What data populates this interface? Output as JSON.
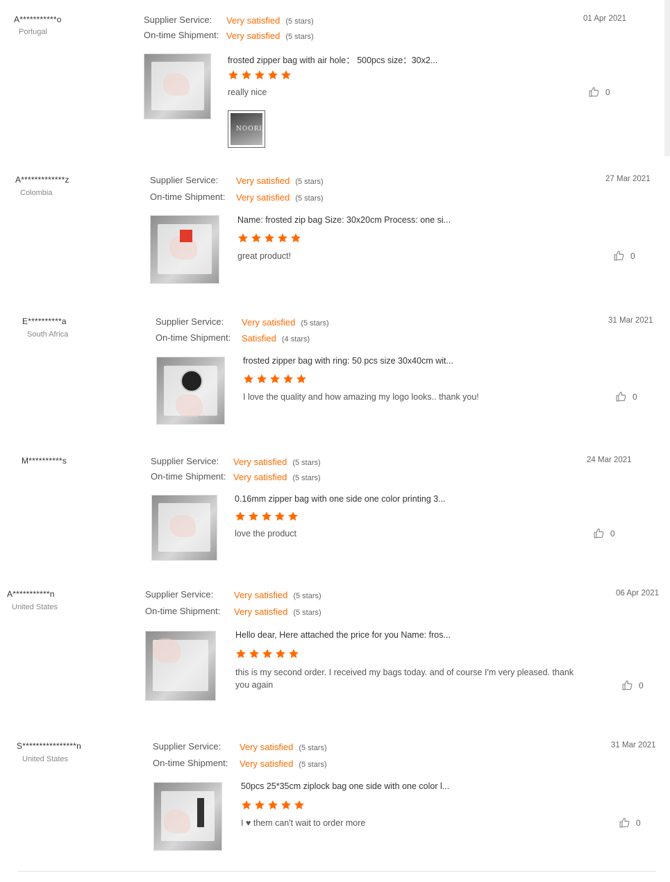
{
  "labels": {
    "supplier_service": "Supplier Service:",
    "on_time_shipment": "On-time Shipment:"
  },
  "colors": {
    "accent": "#ff6a00",
    "star": "#ff6a00"
  },
  "icons": {
    "star": "star-icon",
    "like": "thumbs-up-icon"
  },
  "reviews": [
    {
      "name": "A***********o",
      "country": "Portugal",
      "date": "01 Apr 2021",
      "supplier_service": "Very satisfied",
      "supplier_stars": "(5 stars)",
      "shipment": "Very satisfied",
      "shipment_stars": "(5 stars)",
      "product": "frosted zipper bag with air hole： 500pcs size：30x2...",
      "rating": 5,
      "comment": "really nice",
      "likes": "0",
      "attachment_text": "NOORI"
    },
    {
      "name": "A*************z",
      "country": "Colombia",
      "date": "27 Mar 2021",
      "supplier_service": "Very satisfied",
      "supplier_stars": "(5 stars)",
      "shipment": "Very satisfied",
      "shipment_stars": "(5 stars)",
      "product": "Name: frosted zip bag Size: 30x20cm Process: one si...",
      "rating": 5,
      "comment": "great product!",
      "likes": "0"
    },
    {
      "name": "E**********a",
      "country": "South Africa",
      "date": "31 Mar 2021",
      "supplier_service": "Very satisfied",
      "supplier_stars": "(5 stars)",
      "shipment": "Satisfied",
      "shipment_stars": "(4 stars)",
      "product": "frosted zipper bag with ring: 50 pcs size 30x40cm wit...",
      "rating": 5,
      "comment": "I love the quality and how amazing my logo looks.. thank you!",
      "likes": "0"
    },
    {
      "name": "M**********s",
      "country": "",
      "date": "24 Mar 2021",
      "supplier_service": "Very satisfied",
      "supplier_stars": "(5 stars)",
      "shipment": "Very satisfied",
      "shipment_stars": "(5 stars)",
      "product": "0.16mm zipper bag with one side one color printing 3...",
      "rating": 5,
      "comment": "love the product",
      "likes": "0"
    },
    {
      "name": "A***********n",
      "country": "United States",
      "date": "06 Apr 2021",
      "supplier_service": "Very satisfied",
      "supplier_stars": "(5 stars)",
      "shipment": "Very satisfied",
      "shipment_stars": "(5 stars)",
      "product": "Hello dear, Here attached the price for you Name: fros...",
      "rating": 5,
      "comment": "this is my second order. I received my bags today. and of course I'm very pleased. thank you again",
      "likes": "0"
    },
    {
      "name": "S****************n",
      "country": "United States",
      "date": "31 Mar 2021",
      "supplier_service": "Very satisfied",
      "supplier_stars": "(5 stars)",
      "shipment": "Very satisfied",
      "shipment_stars": "(5 stars)",
      "product": "50pcs 25*35cm ziplock bag one side with one color l...",
      "rating": 5,
      "comment": "I ♥ them can't wait to order more",
      "likes": "0"
    }
  ]
}
